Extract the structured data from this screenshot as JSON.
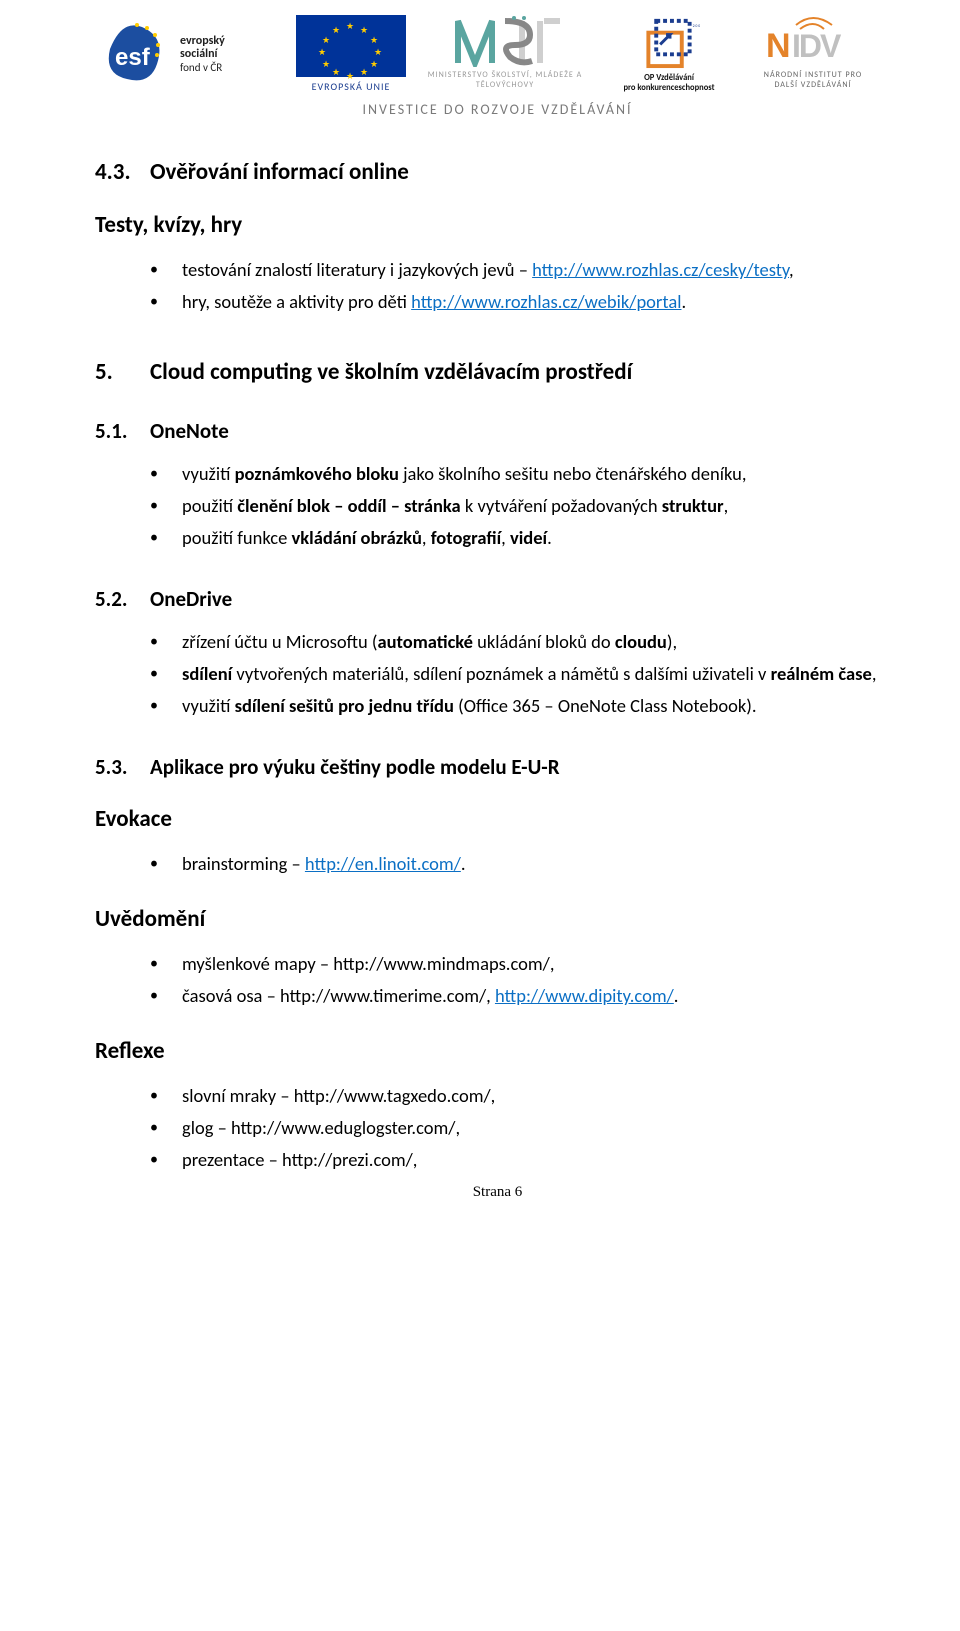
{
  "tagline": "INVESTICE DO ROZVOJE VZDĚLÁVÁNÍ",
  "logos": {
    "esf": {
      "l1": "evropský",
      "l2": "sociální",
      "l3": "fond v ČR"
    },
    "eu": "EVROPSKÁ UNIE",
    "msmt": "MINISTERSTVO ŠKOLSTVÍ, MLÁDEŽE A TĚLOVÝCHOVY",
    "op": {
      "l1": "OP Vzdělávání",
      "l2": "pro konkurenceschopnost"
    },
    "nidv": "NÁRODNÍ INSTITUT PRO DALŠÍ VZDĚLÁVÁNÍ"
  },
  "s43": {
    "no": "4.3.",
    "title": "Ověřování informací online"
  },
  "sub43": "Testy, kvízy, hry",
  "l43": [
    {
      "pre": "testování znalostí literatury i jazykových jevů – ",
      "link": "http://www.rozhlas.cz/cesky/testy",
      "post": ","
    },
    {
      "pre": "hry, soutěže a aktivity pro děti ",
      "link": "http://www.rozhlas.cz/webik/portal",
      "post": "."
    }
  ],
  "s5": {
    "no": "5.",
    "title": "Cloud computing ve školním vzdělávacím prostředí"
  },
  "s51": {
    "no": "5.1.",
    "title": "OneNote"
  },
  "l51": [
    "využití <b>poznámkového bloku</b> jako školního sešitu nebo čtenářského deníku,",
    "použití <b>členění blok – oddíl – stránka</b> k vytváření požadovaných <b>struktur</b>,",
    "použití funkce <b>vkládání obrázků</b>, <b>fotografií</b>, <b>videí</b>."
  ],
  "s52": {
    "no": "5.2.",
    "title": "OneDrive"
  },
  "l52": [
    "zřízení účtu u Microsoftu (<b>automatické</b> ukládání bloků do <b>cloudu</b>),",
    "<b>sdílení</b> vytvořených materiálů, sdílení poznámek a námětů s dalšími uživateli v <b>reálném čase</b>,",
    "využití <b>sdílení sešitů pro jednu třídu</b> (Office 365 – OneNote Class Notebook)."
  ],
  "s53": {
    "no": "5.3.",
    "title": "Aplikace pro výuku češtiny podle modelu E-U-R"
  },
  "sub_ev": "Evokace",
  "l_ev": [
    {
      "pre": "brainstorming – ",
      "link": "http://en.linoit.com/",
      "post": "."
    }
  ],
  "sub_uv": "Uvědomění",
  "l_uv": [
    {
      "pre": "myšlenkové mapy – http://www.mindmaps.com/,"
    },
    {
      "pre": "časová osa – http://www.timerime.com/, ",
      "link": "http://www.dipity.com/",
      "post": "."
    }
  ],
  "sub_rf": "Reflexe",
  "l_rf": [
    "slovní mraky – http://www.tagxedo.com/,",
    "glog – http://www.eduglogster.com/,",
    "prezentace – http://prezi.com/,"
  ],
  "footer": "Strana 6"
}
